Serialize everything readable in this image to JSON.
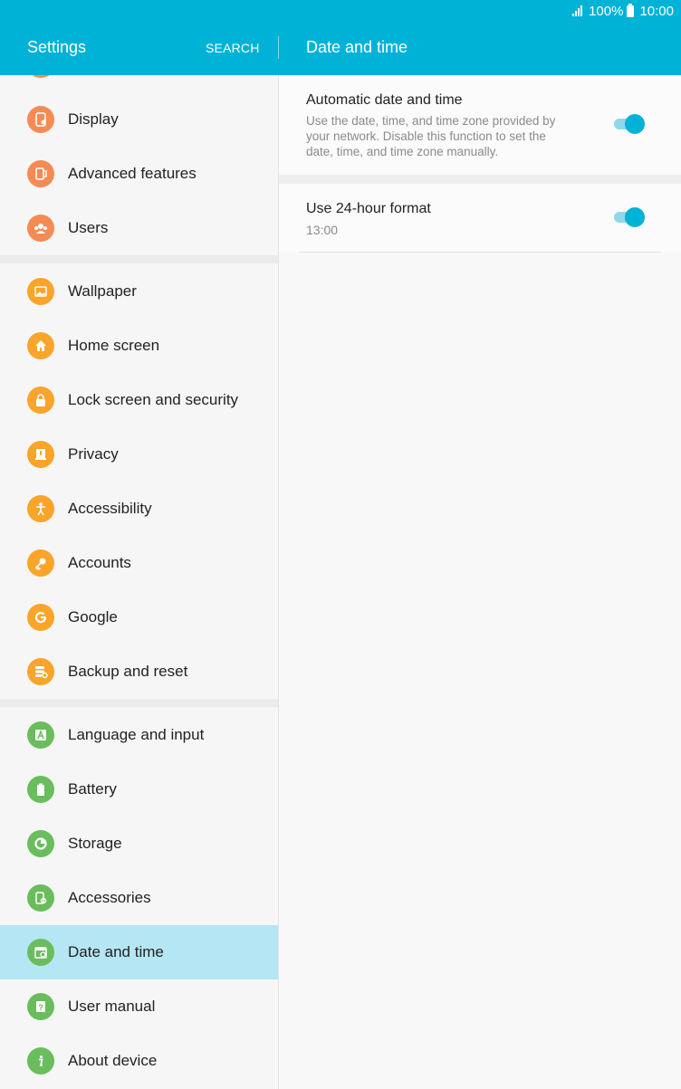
{
  "status_bar": {
    "battery": "100%",
    "time": "10:00"
  },
  "header": {
    "title": "Settings",
    "search": "SEARCH",
    "page_title": "Date and time"
  },
  "sidebar": {
    "items": [
      {
        "label": "Display",
        "icon": "display-icon"
      },
      {
        "label": "Advanced features",
        "icon": "advanced-features-icon"
      },
      {
        "label": "Users",
        "icon": "users-icon"
      },
      {
        "label": "Wallpaper",
        "icon": "wallpaper-icon"
      },
      {
        "label": "Home screen",
        "icon": "home-icon"
      },
      {
        "label": "Lock screen and security",
        "icon": "lock-icon"
      },
      {
        "label": "Privacy",
        "icon": "privacy-icon"
      },
      {
        "label": "Accessibility",
        "icon": "accessibility-icon"
      },
      {
        "label": "Accounts",
        "icon": "key-icon"
      },
      {
        "label": "Google",
        "icon": "google-icon"
      },
      {
        "label": "Backup and reset",
        "icon": "backup-icon"
      },
      {
        "label": "Language and input",
        "icon": "language-icon"
      },
      {
        "label": "Battery",
        "icon": "battery-icon"
      },
      {
        "label": "Storage",
        "icon": "storage-icon"
      },
      {
        "label": "Accessories",
        "icon": "accessories-icon"
      },
      {
        "label": "Date and time",
        "icon": "calendar-icon",
        "selected": true
      },
      {
        "label": "User manual",
        "icon": "help-icon"
      },
      {
        "label": "About device",
        "icon": "info-icon"
      }
    ]
  },
  "settings": {
    "auto_datetime": {
      "title": "Automatic date and time",
      "desc_lines": [
        "Use the date, time, and time zone provided by",
        "your network. Disable this function to set the",
        "date, time, and time zone manually."
      ],
      "enabled": true
    },
    "format_24h": {
      "title": "Use 24-hour format",
      "subtitle": "13:00",
      "enabled": true
    }
  },
  "colors": {
    "accent": "#00b2d6",
    "selected_row": "#b5e6f3",
    "icon_orange": "#f58b54",
    "icon_yellow": "#f9a42b",
    "icon_green": "#6abd5c"
  }
}
